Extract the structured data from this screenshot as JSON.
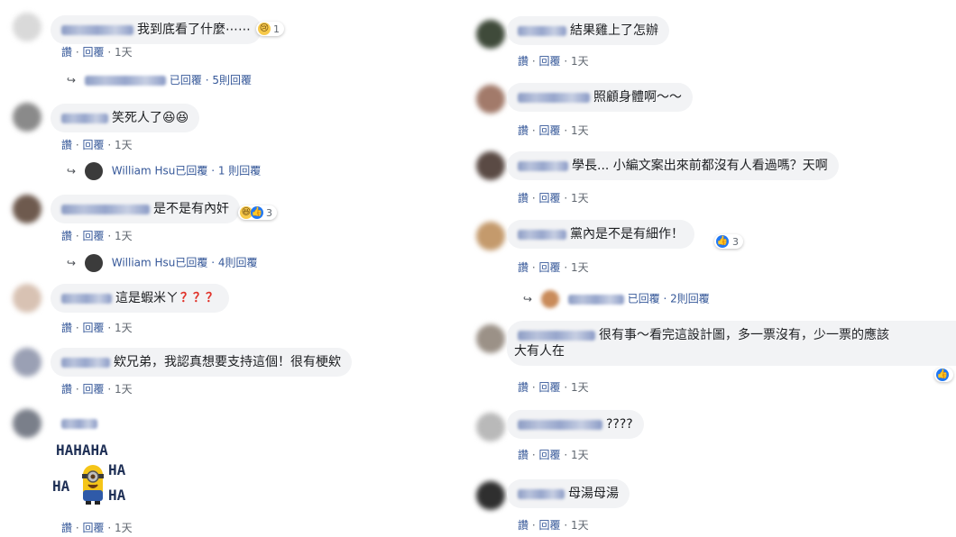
{
  "actions": {
    "like": "讚",
    "reply": "回覆",
    "sep": "·"
  },
  "left": {
    "comments": [
      {
        "text": "我到底看了什麼⋯⋯",
        "time": "1天",
        "reaction_count": "1",
        "reply": {
          "text": "已回覆 · 5則回覆"
        }
      },
      {
        "text": "笑死人了😆😆",
        "time": "1天",
        "reply": {
          "author": "William Hsu",
          "text": "已回覆 · 1 則回覆"
        }
      },
      {
        "text": "是不是有內奸",
        "time": "1天",
        "reaction_count": "3",
        "reply": {
          "author": "William Hsu",
          "text": "已回覆 · 4則回覆"
        }
      },
      {
        "text": "這是蝦米ㄚ",
        "qmarks": "？？？",
        "time": "1天"
      },
      {
        "text": "欸兄弟，我認真想要支持這個！很有梗欸",
        "time": "1天"
      },
      {
        "text": "",
        "time": "1天",
        "sticker": {
          "top": "HAHAHA",
          "r1": "HA",
          "l": "HA",
          "r2": "HA"
        }
      }
    ]
  },
  "right": {
    "comments": [
      {
        "text": "結果雞上了怎辦",
        "time": "1天"
      },
      {
        "text": "照顧身體啊～～",
        "time": "1天"
      },
      {
        "text": "學長... 小編文案出來前都沒有人看過嗎？天啊",
        "time": "1天"
      },
      {
        "text": "黨內是不是有細作！",
        "time": "1天",
        "reaction_count": "3",
        "reply": {
          "text": "已回覆 · 2則回覆"
        }
      },
      {
        "text": "很有事～看完這設計圖，多一票沒有，少一票的應該",
        "text2": "大有人在",
        "time": "1天"
      },
      {
        "text": "????",
        "time": "1天"
      },
      {
        "text": "母湯母湯",
        "time": "1天"
      }
    ]
  }
}
